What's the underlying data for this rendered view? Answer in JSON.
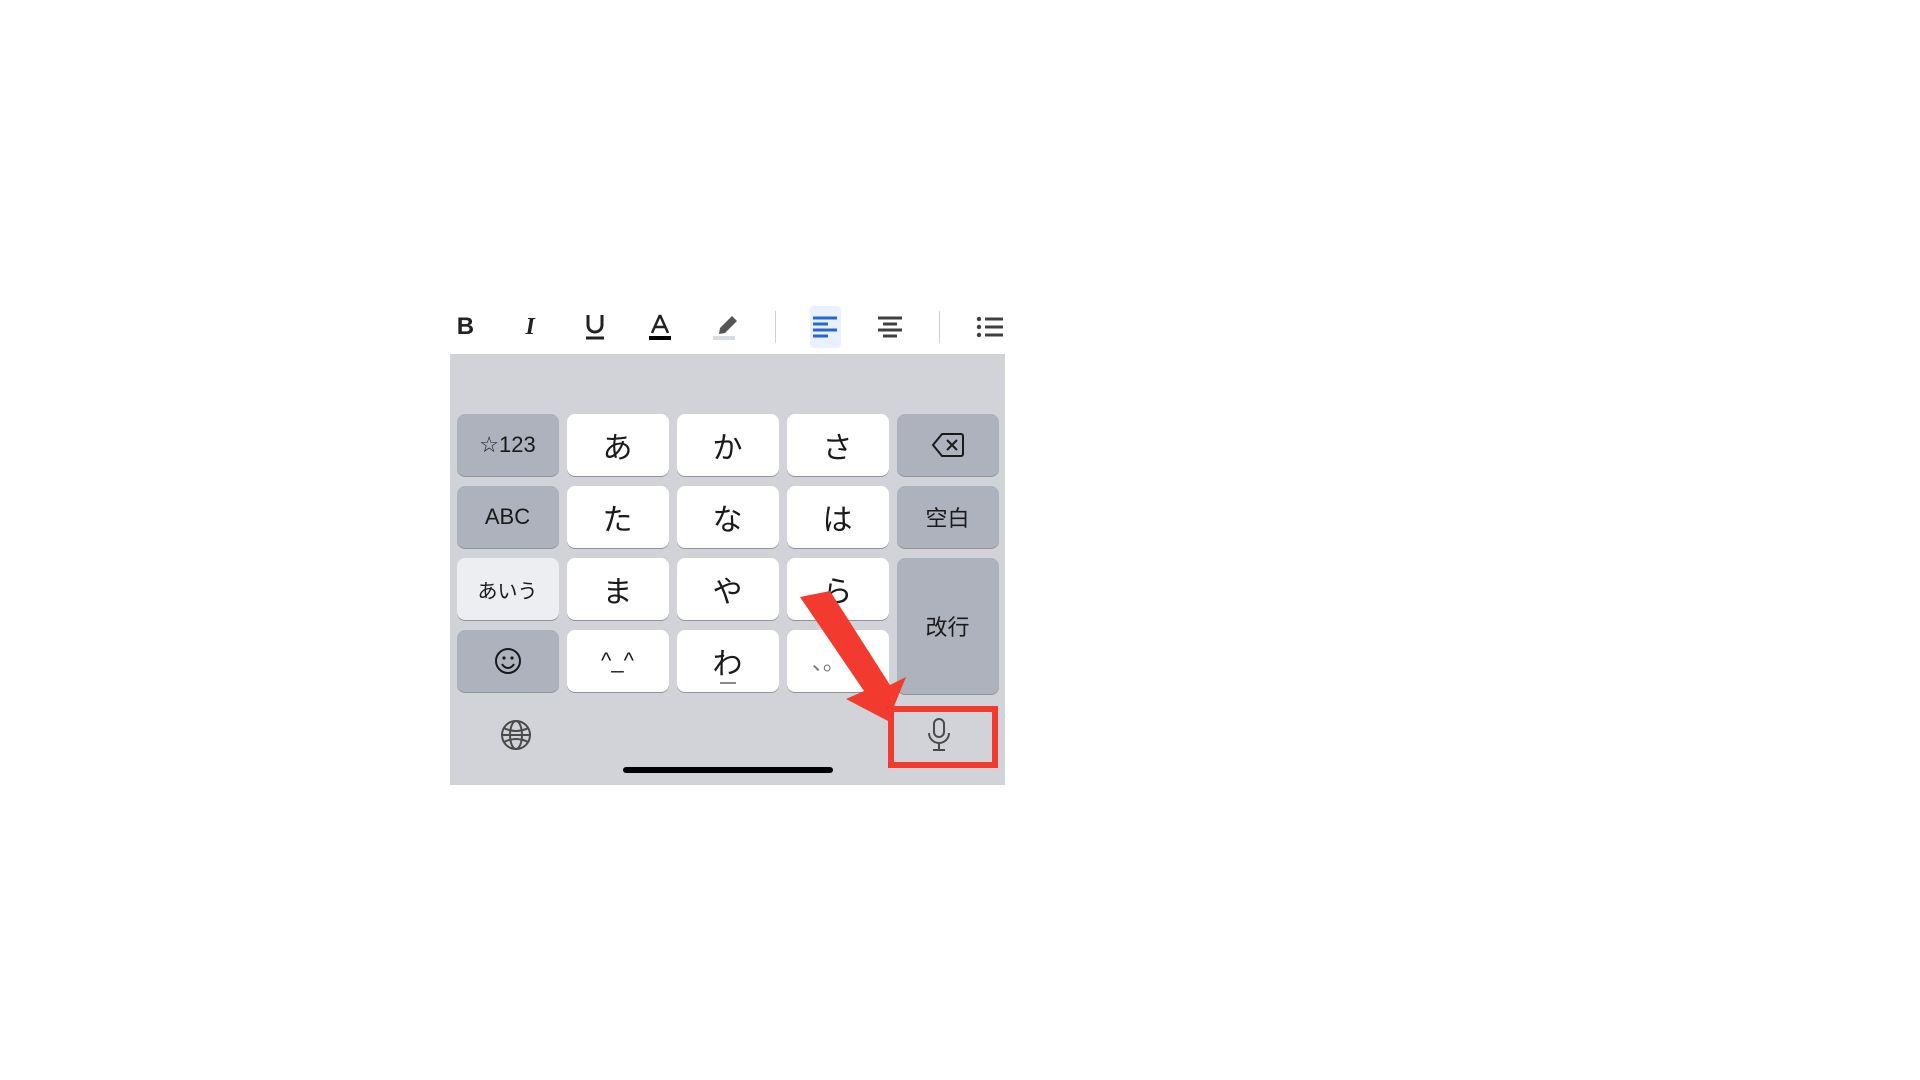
{
  "toolbar": {
    "bold": "B",
    "italic": "I"
  },
  "keyboard": {
    "symbols_key": "☆123",
    "row1": [
      "あ",
      "か",
      "さ"
    ],
    "abc_key": "ABC",
    "row2": [
      "た",
      "な",
      "は"
    ],
    "space": "空白",
    "kana_mode": "あいう",
    "row3": [
      "ま",
      "や",
      "ら"
    ],
    "return": "改行",
    "row4": [
      "^_^",
      "わ",
      "、。?!"
    ]
  },
  "annotation": {
    "highlight_color": "#f33a2e"
  }
}
